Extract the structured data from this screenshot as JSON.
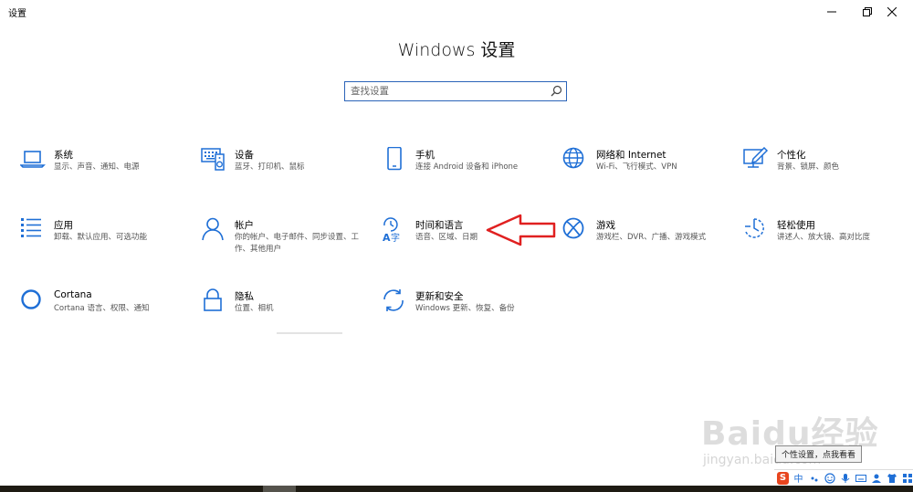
{
  "window": {
    "app_title": "设置",
    "heading": "Windows 设置"
  },
  "search": {
    "placeholder": "查找设置",
    "value": ""
  },
  "tiles": [
    {
      "name": "系统",
      "desc": "显示、声音、通知、电源"
    },
    {
      "name": "设备",
      "desc": "蓝牙、打印机、鼠标"
    },
    {
      "name": "手机",
      "desc": "连接 Android 设备和 iPhone"
    },
    {
      "name": "网络和 Internet",
      "desc": "Wi-Fi、飞行模式、VPN"
    },
    {
      "name": "个性化",
      "desc": "背景、锁屏、颜色"
    },
    {
      "name": "应用",
      "desc": "卸载、默认应用、可选功能"
    },
    {
      "name": "帐户",
      "desc": "你的帐户、电子邮件、同步设置、工作、其他用户"
    },
    {
      "name": "时间和语言",
      "desc": "语音、区域、日期"
    },
    {
      "name": "游戏",
      "desc": "游戏栏、DVR、广播、游戏模式"
    },
    {
      "name": "轻松使用",
      "desc": "讲述人、放大镜、高对比度"
    },
    {
      "name": "Cortana",
      "desc": "Cortana 语言、权限、通知"
    },
    {
      "name": "隐私",
      "desc": "位置、相机"
    },
    {
      "name": "更新和安全",
      "desc": "Windows 更新、恢复、备份"
    }
  ],
  "icons": [
    "laptop-icon",
    "keyboard-icon",
    "phone-icon",
    "globe-icon",
    "paint-icon",
    "apps-list-icon",
    "person-icon",
    "time-language-icon",
    "xbox-icon",
    "ease-of-access-icon",
    "cortana-ring-icon",
    "lock-icon",
    "sync-icon"
  ],
  "annotation": {
    "arrow_color": "#e02020"
  },
  "watermark": {
    "brand": "Baidu经验",
    "url": "jingyan.baidu.com"
  },
  "tooltip": {
    "text": "个性设置，点我看看"
  },
  "ime_bar": {
    "logo": "S",
    "lang": "中"
  },
  "colors": {
    "accent": "#1f6fd6",
    "search_border": "#2b63b8"
  }
}
